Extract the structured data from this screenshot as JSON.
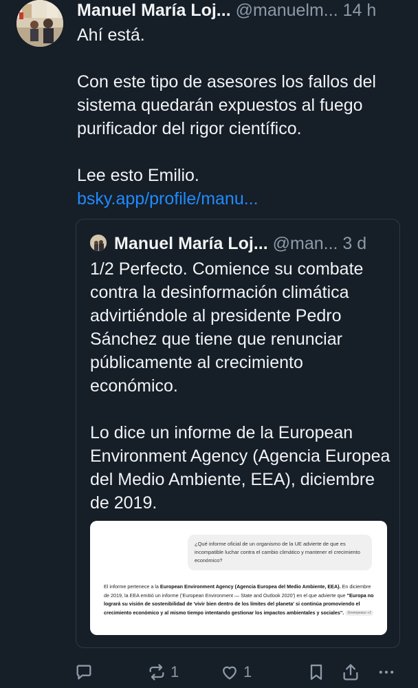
{
  "post": {
    "author_name": "Manuel María Loj...",
    "author_handle": "@manuelm...",
    "time": "14 h",
    "text": {
      "line1": "Ahí está.",
      "line2": "Con este tipo de asesores los fallos del sistema quedarán expuestos al fuego purificador del rigor científico.",
      "line3": "Lee esto Emilio.",
      "link": "bsky.app/profile/manu..."
    }
  },
  "quote": {
    "author_name": "Manuel María Loj...",
    "author_handle": "@man...",
    "time": "3 d",
    "paragraph1": "1/2 Perfecto. Comience su combate contra la desinformación climática advirtiéndole al presidente Pedro Sánchez que tiene que renunciar públicamente al crecimiento económico.",
    "paragraph2": "Lo dice un informe de la European Environment Agency (Agencia Europea del Medio Ambiente, EEA), diciembre de 2019.",
    "embed": {
      "question": "¿Qué informe oficial de un organismo de la UE advierte de que es incompatible luchar contra el cambio climático y mantener el crecimiento económico?",
      "answer_intro": "El informe pertenece a la ",
      "answer_bold1": "European Environment Agency (Agencia Europea del Medio Ambiente, EEA).",
      "answer_mid": " En diciembre de 2019, la EEA emitió un informe ('European Environment — State and Outlook 2020') en el que advierte que ",
      "answer_bold2": "\"Europa no logrará su visión de sostenibilidad de 'vivir bien dentro de los límites del planeta' si continúa promoviendo el crecimiento económico y al mismo tiempo intentando gestionar los impactos ambientales y sociales\".",
      "chip": "Greenpeace +2"
    }
  },
  "actions": {
    "reply_count": "",
    "repost_count": "1",
    "like_count": "1"
  },
  "colors": {
    "background": "#161e27",
    "text": "#f1f3f5",
    "muted": "#8c9aaa",
    "link": "#208bfe",
    "border": "#2e3a48"
  },
  "icons": [
    "reply-icon",
    "repost-icon",
    "like-icon",
    "bookmark-icon",
    "share-icon",
    "more-icon"
  ]
}
